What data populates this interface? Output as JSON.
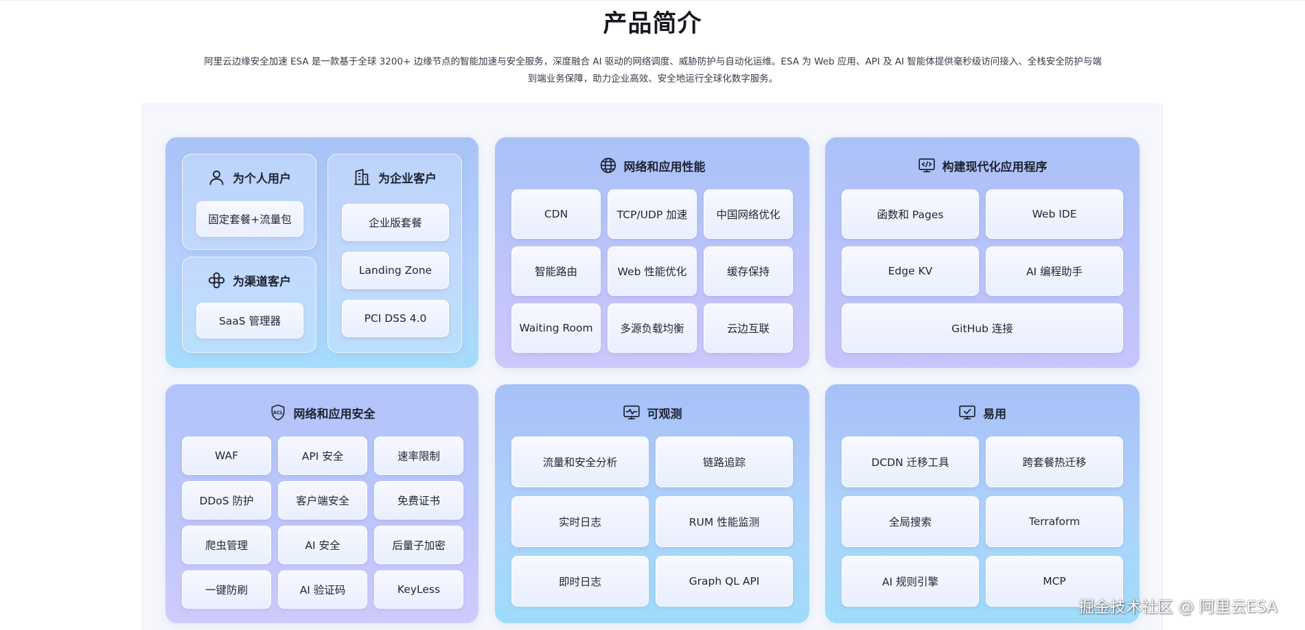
{
  "header": {
    "title": "产品简介",
    "intro": "阿里云边缘安全加速 ESA 是一款基于全球 3200+ 边缘节点的智能加速与安全服务，深度融合 AI 驱动的网络调度、威胁防护与自动化运维。ESA 为 Web 应用、API 及 AI 智能体提供毫秒级访问接入、全栈安全防护与端到端业务保障，助力企业高效、安全地运行全球化数字服务。"
  },
  "customers": {
    "personal": {
      "title": "为个人用户",
      "icon": "user-icon",
      "items": [
        "固定套餐+流量包"
      ]
    },
    "channel": {
      "title": "为渠道客户",
      "icon": "channel-icon",
      "items": [
        "SaaS 管理器"
      ]
    },
    "enterprise": {
      "title": "为企业客户",
      "icon": "building-icon",
      "items": [
        "企业版套餐",
        "Landing Zone",
        "PCI DSS 4.0"
      ]
    }
  },
  "performance": {
    "title": "网络和应用性能",
    "icon": "globe-icon",
    "items": [
      "CDN",
      "TCP/UDP 加速",
      "中国网络优化",
      "智能路由",
      "Web 性能优化",
      "缓存保持",
      "Waiting Room",
      "多源负载均衡",
      "云边互联"
    ]
  },
  "modern_apps": {
    "title": "构建现代化应用程序",
    "icon": "code-window-icon",
    "items": [
      "函数和 Pages",
      "Web IDE",
      "Edge KV",
      "AI 编程助手",
      "GitHub 连接"
    ]
  },
  "security": {
    "title": "网络和应用安全",
    "icon": "acl-shield-icon",
    "icon_text": "ACL",
    "items": [
      "WAF",
      "API 安全",
      "速率限制",
      "DDoS 防护",
      "客户端安全",
      "免费证书",
      "爬虫管理",
      "AI 安全",
      "后量子加密",
      "一键防刷",
      "AI 验证码",
      "KeyLess"
    ]
  },
  "observability": {
    "title": "可观测",
    "icon": "monitor-pulse-icon",
    "items": [
      "流量和安全分析",
      "链路追踪",
      "实时日志",
      "RUM 性能监测",
      "即时日志",
      "Graph QL API"
    ]
  },
  "usability": {
    "title": "易用",
    "icon": "monitor-check-icon",
    "items": [
      "DCDN 迁移工具",
      "跨套餐热迁移",
      "全局搜索",
      "Terraform",
      "AI 规则引擎",
      "MCP"
    ]
  },
  "watermark": "掘金技术社区 @ 阿里云ESA"
}
